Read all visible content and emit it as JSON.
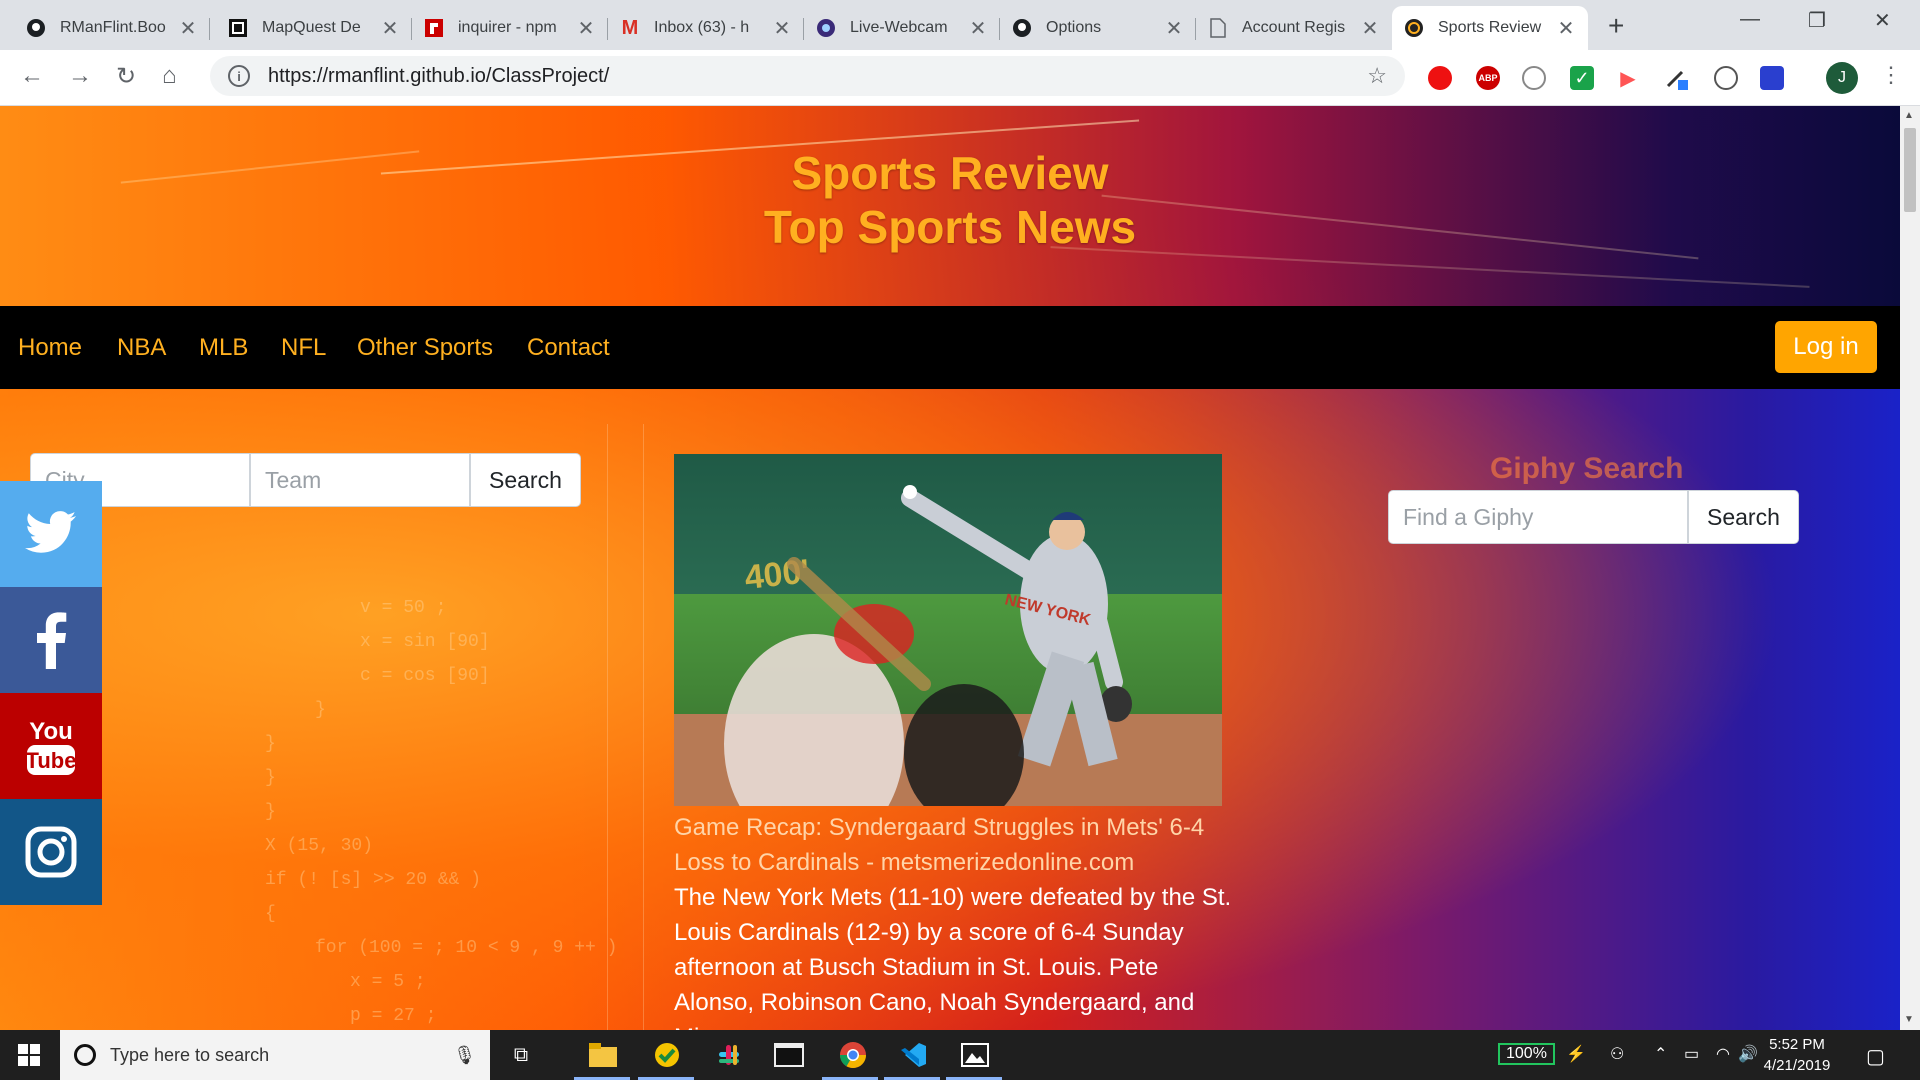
{
  "browser": {
    "tabs": [
      {
        "label": "RManFlint.Boo",
        "icon": "github-icon"
      },
      {
        "label": "MapQuest De",
        "icon": "mapquest-icon"
      },
      {
        "label": "inquirer - npm",
        "icon": "npm-icon"
      },
      {
        "label": "Inbox (63) - h",
        "icon": "gmail-icon"
      },
      {
        "label": "Live-Webcam",
        "icon": "webcam-icon"
      },
      {
        "label": "Options",
        "icon": "github-icon"
      },
      {
        "label": "Account Regis",
        "icon": "document-icon"
      },
      {
        "label": "Sports Review",
        "icon": "site-icon",
        "active": true
      }
    ],
    "url": "https://rmanflint.github.io/ClassProject/",
    "profile_initial": "J"
  },
  "page": {
    "hero": {
      "title": "Sports Review",
      "subtitle": "Top Sports News"
    },
    "nav": {
      "links": [
        "Home",
        "NBA",
        "MLB",
        "NFL",
        "Other Sports",
        "Contact"
      ],
      "login": "Log in"
    },
    "team_search": {
      "city_placeholder": "City",
      "team_placeholder": "Team",
      "button": "Search"
    },
    "giphy": {
      "title": "Giphy Search",
      "placeholder": "Find a Giphy",
      "button": "Search"
    },
    "social": [
      {
        "name": "twitter",
        "color": "#55acee"
      },
      {
        "name": "facebook",
        "color": "#3b5998"
      },
      {
        "name": "youtube",
        "color": "#bb0000"
      },
      {
        "name": "instagram",
        "color": "#125688"
      }
    ],
    "article": {
      "headline": "Game Recap: Syndergaard Struggles in Mets' 6-4 Loss to Cardinals - metsmerizedonline.com",
      "description": "The New York Mets (11-10) were defeated by the St. Louis Cardinals (12-9) by a score of 6-4 Sunday afternoon at Busch Stadium in St. Louis. Pete Alonso, Robinson Cano, Noah Syndergaard, and Mi..."
    },
    "background_code": [
      "v = 50 ;",
      "x = sin [90]",
      "c = cos [90]",
      "}",
      "}",
      "}",
      "}",
      "X (15, 30)",
      "if (! [s] >> 20 && )",
      "{",
      "for (100 = ; 10 < 9 , 9 ++ )",
      "x = 5 ;",
      "p = 27 ;"
    ]
  },
  "taskbar": {
    "search_placeholder": "Type here to search",
    "battery": "100%",
    "time": "5:52 PM",
    "date": "4/21/2019"
  }
}
